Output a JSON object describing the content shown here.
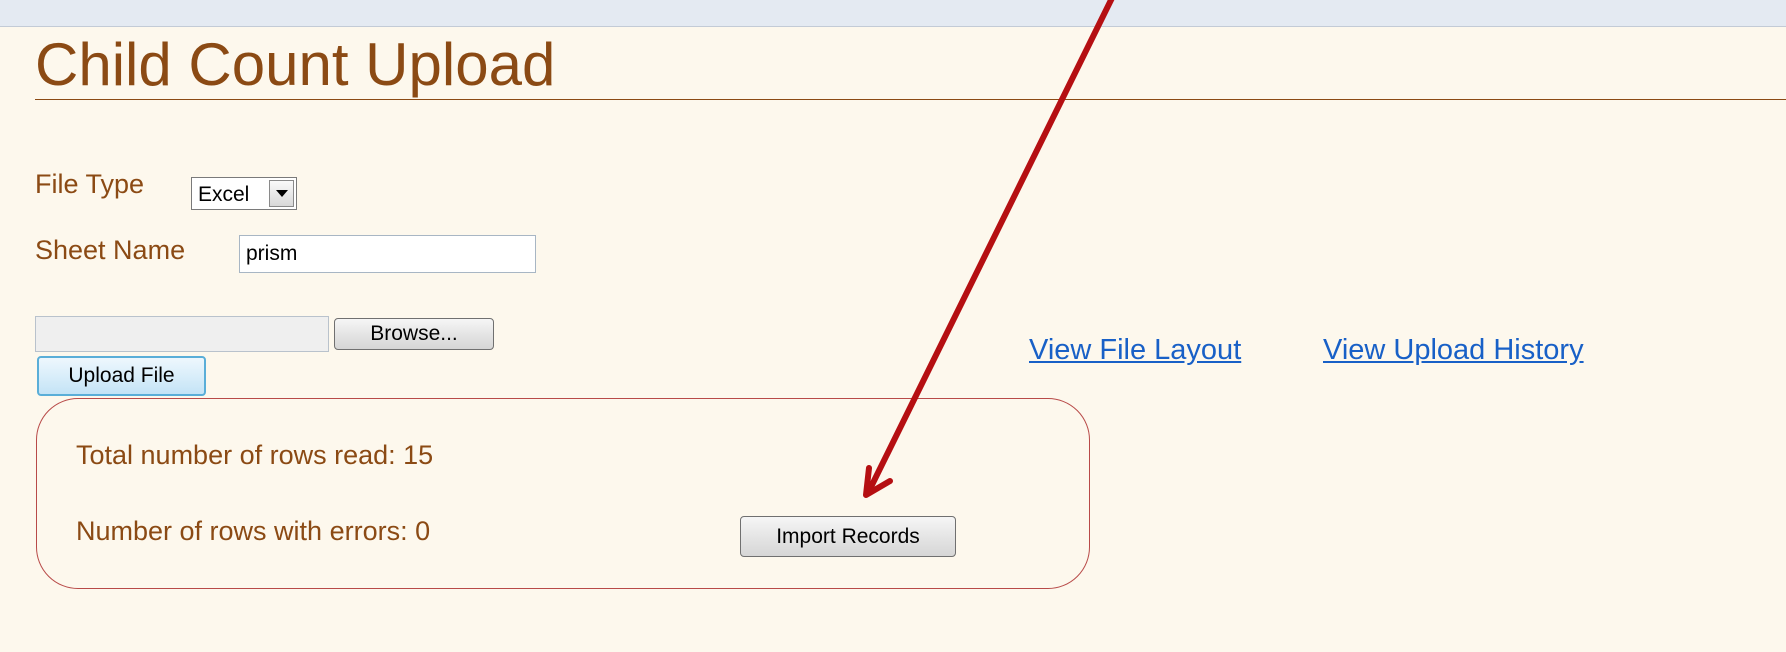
{
  "header": {
    "title": "Child Count Upload"
  },
  "form": {
    "file_type_label": "File Type",
    "file_type_value": "Excel",
    "sheet_name_label": "Sheet Name",
    "sheet_name_value": "prism",
    "file_path_value": "",
    "browse_label": "Browse...",
    "upload_label": "Upload File"
  },
  "links": {
    "view_file_layout": "View File Layout",
    "view_upload_history": "View Upload History"
  },
  "results": {
    "total_rows_label": "Total number of rows read: 15",
    "error_rows_label": "Number of rows with errors: 0",
    "import_label": "Import Records"
  },
  "colors": {
    "title": "#8b4a14",
    "link": "#1860c7",
    "result_border": "#b84a48",
    "annotation_arrow": "#b50f12",
    "page_background": "#fdf8ed"
  }
}
